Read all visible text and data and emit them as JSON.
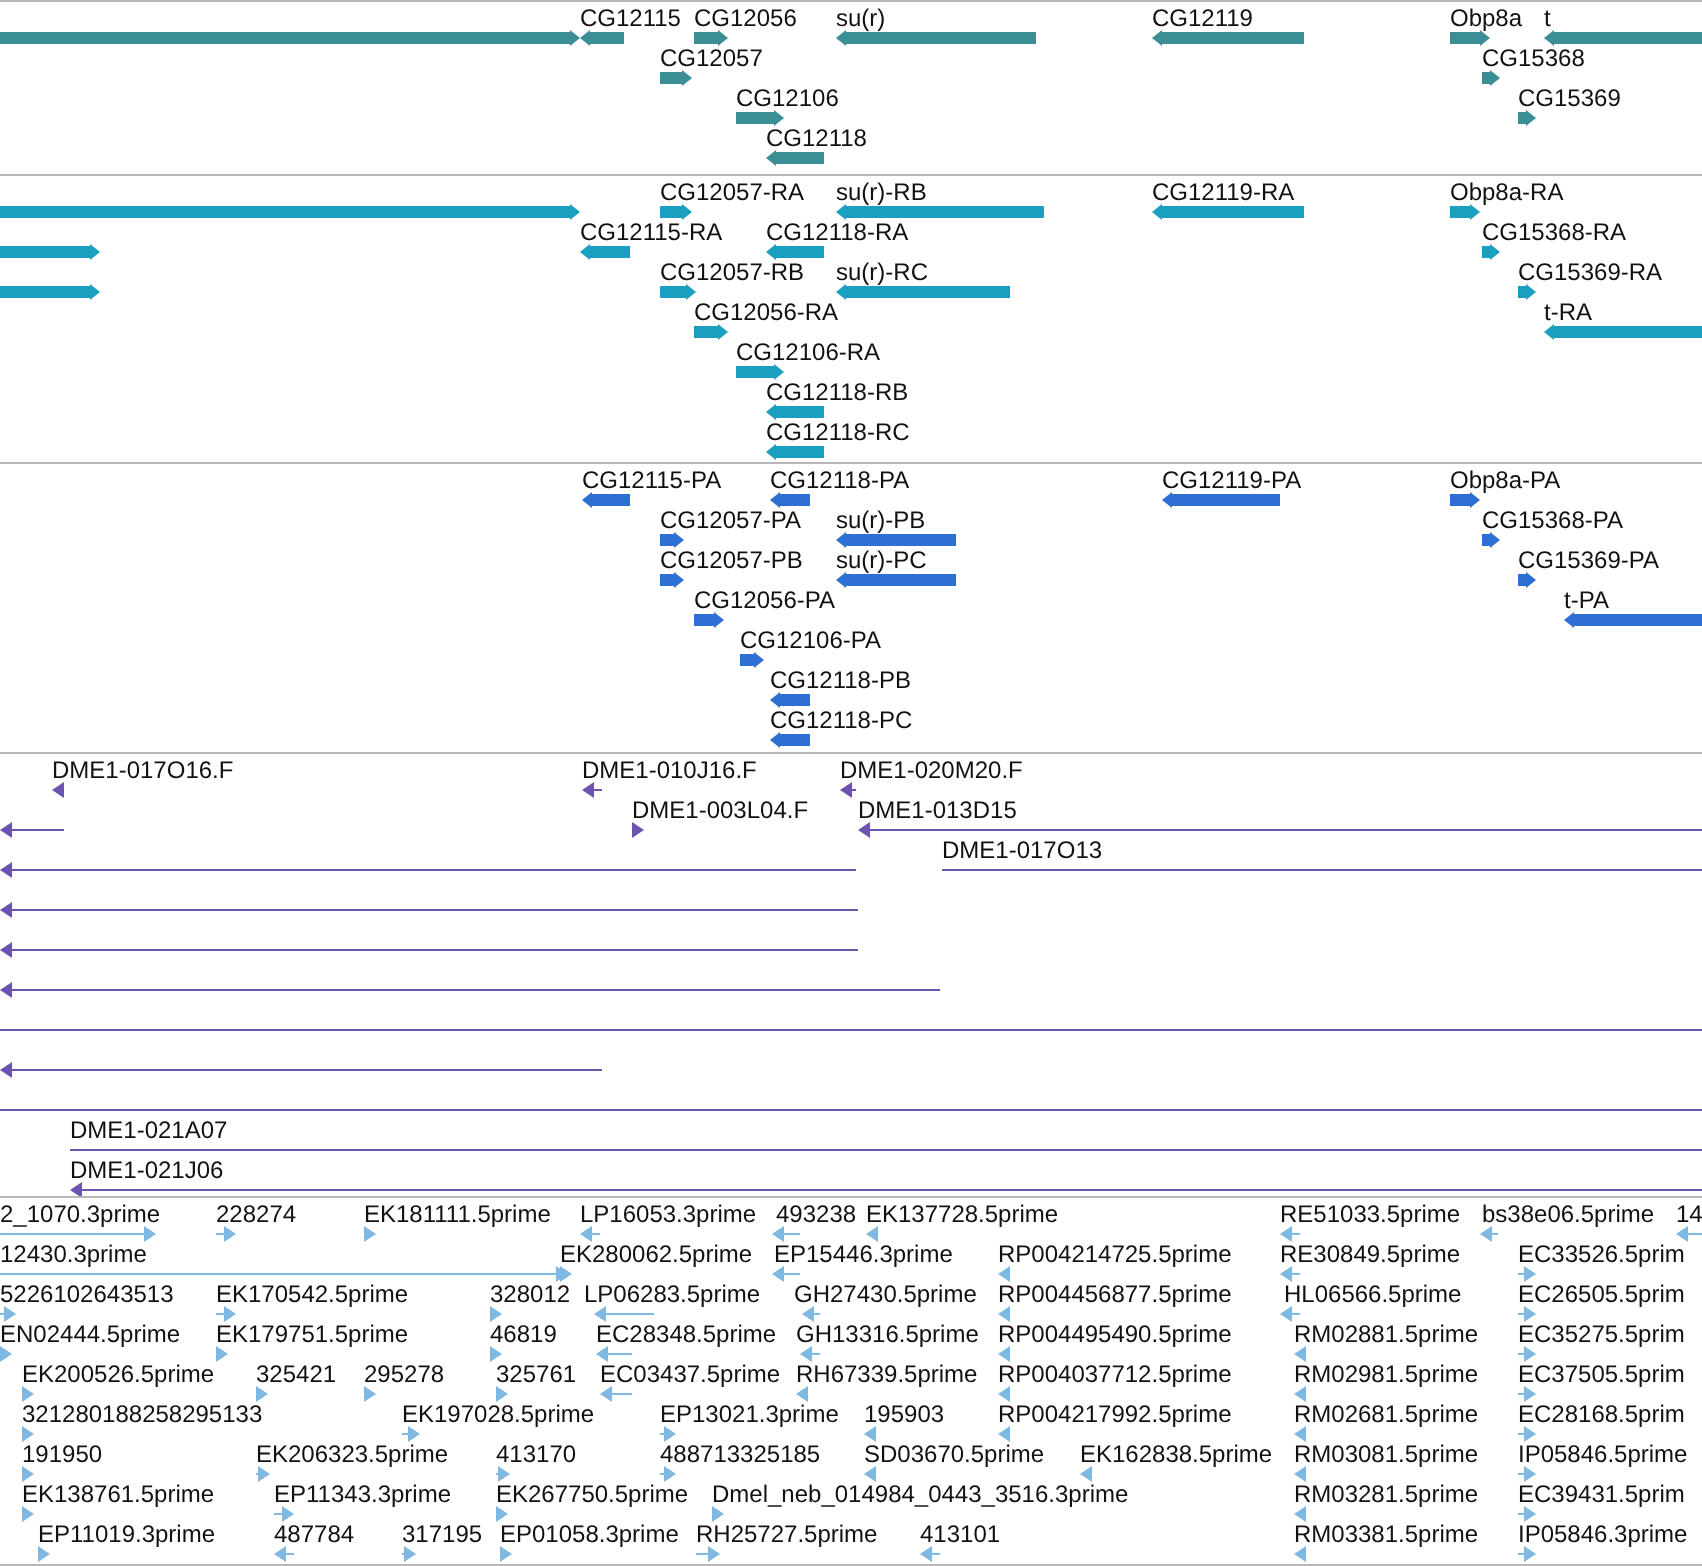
{
  "tracks": [
    {
      "color": "#3a8e94",
      "features": [
        {
          "reverse": false
        },
        {
          "label": "CG12115",
          "reverse": true
        },
        {
          "label": "CG12056",
          "reverse": false
        },
        {
          "label": "su(r)",
          "reverse": true
        },
        {
          "label": "CG12119",
          "reverse": true
        },
        {
          "label": "Obp8a",
          "reverse": false
        },
        {
          "label": "t",
          "reverse": true
        },
        {
          "label": "CG12057",
          "reverse": false
        },
        {
          "label": "CG15368",
          "reverse": false
        },
        {
          "label": "CG12106",
          "reverse": false
        },
        {
          "label": "CG15369",
          "reverse": false
        },
        {
          "label": "CG12118",
          "reverse": true
        }
      ]
    },
    {
      "color": "#1a9fc0",
      "features": [
        {
          "reverse": false
        },
        {
          "label": "CG12057-RA",
          "reverse": false
        },
        {
          "label": "su(r)-RB",
          "reverse": true
        },
        {
          "label": "CG12119-RA",
          "reverse": true
        },
        {
          "label": "Obp8a-RA",
          "reverse": false
        },
        {
          "reverse": false
        },
        {
          "label": "CG12115-RA",
          "reverse": true
        },
        {
          "label": "CG12118-RA",
          "reverse": true
        },
        {
          "label": "CG15368-RA",
          "reverse": false
        },
        {
          "reverse": false
        },
        {
          "label": "CG12057-RB",
          "reverse": false
        },
        {
          "label": "su(r)-RC",
          "reverse": true
        },
        {
          "label": "CG15369-RA",
          "reverse": false
        },
        {
          "label": "CG12056-RA",
          "reverse": false
        },
        {
          "label": "t-RA",
          "reverse": true
        },
        {
          "label": "CG12106-RA",
          "reverse": false
        },
        {
          "label": "CG12118-RB",
          "reverse": true
        },
        {
          "label": "CG12118-RC",
          "reverse": true
        }
      ]
    },
    {
      "color": "#2e6fd4",
      "features": [
        {
          "label": "CG12115-PA",
          "reverse": true
        },
        {
          "label": "CG12118-PA",
          "reverse": true
        },
        {
          "label": "CG12119-PA",
          "reverse": true
        },
        {
          "label": "Obp8a-PA",
          "reverse": false
        },
        {
          "label": "CG12057-PA",
          "reverse": false
        },
        {
          "label": "su(r)-PB",
          "reverse": true
        },
        {
          "label": "CG15368-PA",
          "reverse": false
        },
        {
          "label": "CG12057-PB",
          "reverse": false
        },
        {
          "label": "su(r)-PC",
          "reverse": true
        },
        {
          "label": "CG15369-PA",
          "reverse": false
        },
        {
          "label": "CG12056-PA",
          "reverse": false
        },
        {
          "label": "t-PA",
          "reverse": true
        },
        {
          "label": "CG12106-PA",
          "reverse": false
        },
        {
          "label": "CG12118-PB",
          "reverse": true
        },
        {
          "label": "CG12118-PC",
          "reverse": true
        }
      ]
    },
    {
      "color": "#6e52b0",
      "features": [
        {
          "label": "DME1-017O16.F",
          "reverse": true
        },
        {
          "label": "DME1-010J16.F",
          "reverse": true
        },
        {
          "label": "DME1-020M20.F",
          "reverse": true
        },
        {
          "reverse": true
        },
        {
          "label": "DME1-003L04.F",
          "reverse": false
        },
        {
          "label": "DME1-013D15",
          "reverse": true
        },
        {
          "reverse": true
        },
        {
          "label": "DME1-017O13",
          "reverse": false
        },
        {
          "reverse": true
        },
        {
          "reverse": true
        },
        {
          "reverse": true
        },
        {
          "reverse": false
        },
        {
          "reverse": true
        },
        {
          "reverse": false
        },
        {
          "label": "DME1-021A07",
          "reverse": false
        },
        {
          "label": "DME1-021J06",
          "reverse": true
        }
      ]
    },
    {
      "color": "#7fb8e0",
      "features": [
        {
          "label": "2_1070.3prime",
          "reverse": false
        },
        {
          "label": "228274",
          "reverse": false
        },
        {
          "label": "EK181111.5prime",
          "reverse": false
        },
        {
          "label": "LP16053.3prime",
          "reverse": true
        },
        {
          "label": "493238",
          "reverse": true
        },
        {
          "label": "EK137728.5prime",
          "reverse": true
        },
        {
          "label": "RE51033.5prime",
          "reverse": true
        },
        {
          "label": "bs38e06.5prime",
          "reverse": true
        },
        {
          "label": "14",
          "reverse": true
        },
        {
          "label": "12430.3prime",
          "reverse": false
        },
        {
          "label": "EK280062.5prime",
          "reverse": false
        },
        {
          "label": "EP15446.3prime",
          "reverse": true
        },
        {
          "label": "RP004214725.5prime",
          "reverse": true
        },
        {
          "label": "RE30849.5prime",
          "reverse": true
        },
        {
          "label": "EC33526.5prim",
          "reverse": false
        },
        {
          "label": "5226102643513",
          "reverse": false
        },
        {
          "label": "EK170542.5prime",
          "reverse": false
        },
        {
          "label": "328012",
          "reverse": false
        },
        {
          "label": "LP06283.5prime",
          "reverse": true
        },
        {
          "label": "GH27430.5prime",
          "reverse": true
        },
        {
          "label": "RP004456877.5prime",
          "reverse": true
        },
        {
          "label": "HL06566.5prime",
          "reverse": true
        },
        {
          "label": "EC26505.5prim",
          "reverse": false
        },
        {
          "label": "EN02444.5prime",
          "reverse": false
        },
        {
          "label": "EK179751.5prime",
          "reverse": false
        },
        {
          "label": "46819",
          "reverse": false
        },
        {
          "label": "EC28348.5prime",
          "reverse": true
        },
        {
          "label": "GH13316.5prime",
          "reverse": true
        },
        {
          "label": "RP004495490.5prime",
          "reverse": true
        },
        {
          "label": "RM02881.5prime",
          "reverse": true
        },
        {
          "label": "EC35275.5prim",
          "reverse": false
        },
        {
          "label": "EK200526.5prime",
          "reverse": false
        },
        {
          "label": "325421",
          "reverse": false
        },
        {
          "label": "295278",
          "reverse": false
        },
        {
          "label": "325761",
          "reverse": false
        },
        {
          "label": "EC03437.5prime",
          "reverse": true
        },
        {
          "label": "RH67339.5prime",
          "reverse": true
        },
        {
          "label": "RP004037712.5prime",
          "reverse": true
        },
        {
          "label": "RM02981.5prime",
          "reverse": true
        },
        {
          "label": "EC37505.5prim",
          "reverse": false
        },
        {
          "label": "321280188258295133",
          "reverse": false
        },
        {
          "label": "EK197028.5prime",
          "reverse": false
        },
        {
          "label": "EP13021.3prime",
          "reverse": false
        },
        {
          "label": "195903",
          "reverse": true
        },
        {
          "label": "RP004217992.5prime",
          "reverse": true
        },
        {
          "label": "RM02681.5prime",
          "reverse": true
        },
        {
          "label": "EC28168.5prim",
          "reverse": false
        },
        {
          "label": "191950",
          "reverse": false
        },
        {
          "label": "EK206323.5prime",
          "reverse": false
        },
        {
          "label": "413170",
          "reverse": false
        },
        {
          "label": "488713325185",
          "reverse": false
        },
        {
          "label": "SD03670.5prime",
          "reverse": true
        },
        {
          "label": "EK162838.5prime",
          "reverse": true
        },
        {
          "label": "RM03081.5prime",
          "reverse": true
        },
        {
          "label": "IP05846.5prime",
          "reverse": false
        },
        {
          "label": "EK138761.5prime",
          "reverse": false
        },
        {
          "label": "EP11343.3prime",
          "reverse": false
        },
        {
          "label": "EK267750.5prime",
          "reverse": false
        },
        {
          "label": "Dmel_neb_014984_0443_3516.3prime",
          "reverse": false
        },
        {
          "label": "RM03281.5prime",
          "reverse": true
        },
        {
          "label": "EC39431.5prim",
          "reverse": false
        },
        {
          "label": "EP11019.3prime",
          "reverse": false
        },
        {
          "label": "487784",
          "reverse": true
        },
        {
          "label": "317195",
          "reverse": false
        },
        {
          "label": "EP01058.3prime",
          "reverse": false
        },
        {
          "label": "RH25727.5prime",
          "reverse": false
        },
        {
          "label": "413101",
          "reverse": true
        },
        {
          "label": "RM03381.5prime",
          "reverse": true
        },
        {
          "label": "IP05846.3prime",
          "reverse": false
        }
      ]
    }
  ]
}
